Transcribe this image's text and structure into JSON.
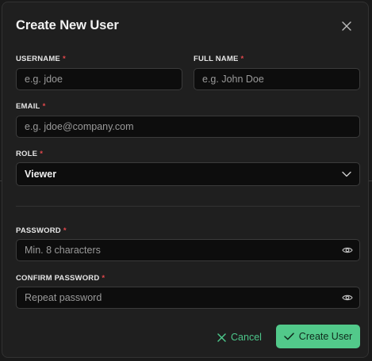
{
  "dialog": {
    "title": "Create New User",
    "required_marker": "*"
  },
  "fields": {
    "username": {
      "label": "USERNAME",
      "placeholder": "e.g. jdoe",
      "value": ""
    },
    "full_name": {
      "label": "FULL NAME",
      "placeholder": "e.g. John Doe",
      "value": ""
    },
    "email": {
      "label": "EMAIL",
      "placeholder": "e.g. jdoe@company.com",
      "value": ""
    },
    "role": {
      "label": "ROLE",
      "selected": "Viewer"
    },
    "password": {
      "label": "PASSWORD",
      "placeholder": "Min. 8 characters",
      "value": ""
    },
    "confirm_password": {
      "label": "CONFIRM PASSWORD",
      "placeholder": "Repeat password",
      "value": ""
    }
  },
  "actions": {
    "cancel_label": "Cancel",
    "create_label": "Create User"
  },
  "icons": {
    "close": "close-icon",
    "chevron": "chevron-down-icon",
    "eye": "eye-icon",
    "cancel": "x-icon",
    "create": "check-icon"
  },
  "colors": {
    "accent": "#52c98a",
    "accent_text": "#4cc68a",
    "required": "#e5484d",
    "surface": "#1f1f1f",
    "input_bg": "#0d0d0d"
  }
}
